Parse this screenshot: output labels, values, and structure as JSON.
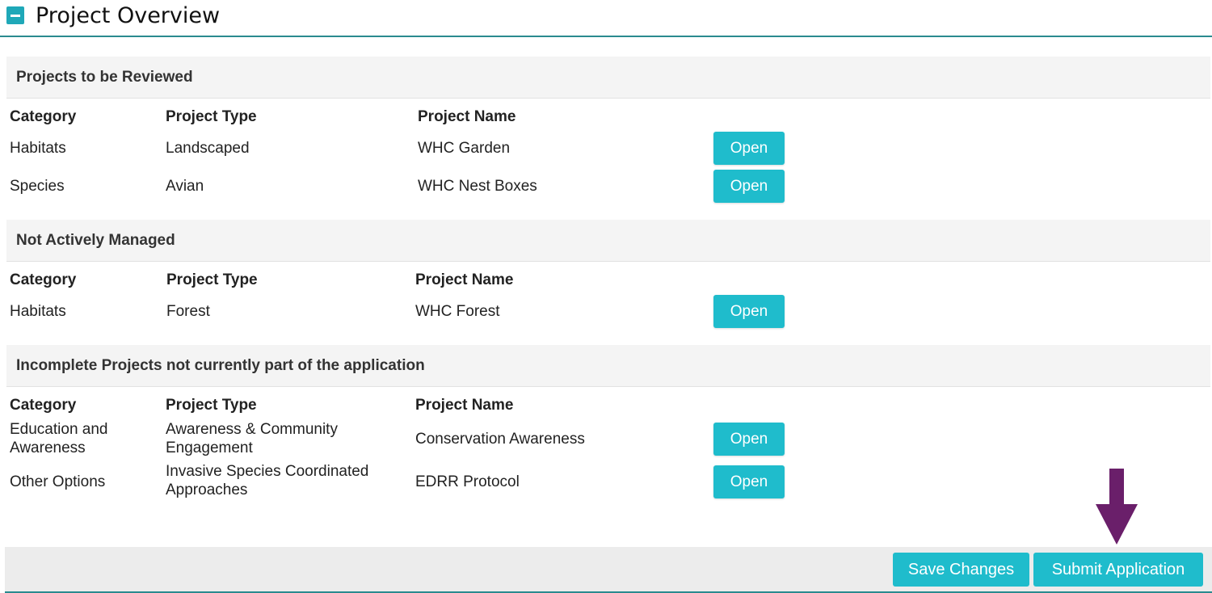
{
  "page": {
    "title": "Project Overview"
  },
  "columns": {
    "category": "Category",
    "project_type": "Project Type",
    "project_name": "Project Name"
  },
  "sections": [
    {
      "title": "Projects to be Reviewed",
      "rows": [
        {
          "category": "Habitats",
          "type": "Landscaped",
          "name": "WHC Garden",
          "action": "Open"
        },
        {
          "category": "Species",
          "type": "Avian",
          "name": "WHC Nest Boxes",
          "action": "Open"
        }
      ]
    },
    {
      "title": "Not Actively Managed",
      "rows": [
        {
          "category": "Habitats",
          "type": "Forest",
          "name": "WHC Forest",
          "action": "Open"
        }
      ]
    },
    {
      "title": "Incomplete Projects not currently part of the application",
      "rows": [
        {
          "category": "Education and Awareness",
          "type": "Awareness & Community Engagement",
          "name": "Conservation Awareness",
          "action": "Open"
        },
        {
          "category": "Other Options",
          "type": "Invasive Species Coordinated Approaches",
          "name": "EDRR Protocol",
          "action": "Open"
        }
      ]
    }
  ],
  "footer": {
    "save_label": "Save Changes",
    "submit_label": "Submit Application"
  },
  "colors": {
    "accent": "#1fbccc",
    "header_rule": "#2a8a8f",
    "arrow": "#6a1f6a"
  },
  "icons": {
    "collapse": "minus-square-icon",
    "annotation": "arrow-down-icon"
  }
}
